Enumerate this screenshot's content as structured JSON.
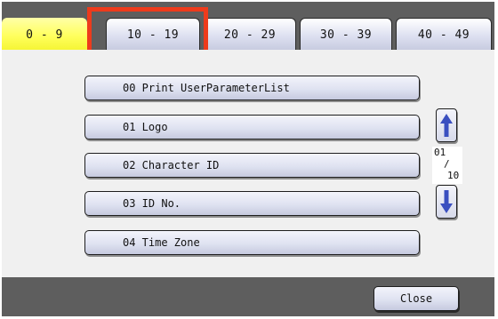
{
  "tabs": [
    {
      "label": "0 - 9",
      "active": true
    },
    {
      "label": "10 - 19",
      "active": false
    },
    {
      "label": "20 - 29",
      "active": false
    },
    {
      "label": "30 - 39",
      "active": false
    },
    {
      "label": "40 - 49",
      "active": false
    }
  ],
  "parameters": [
    {
      "label": "00  Print UserParameterList"
    },
    {
      "label": "01  Logo"
    },
    {
      "label": "02  Character ID"
    },
    {
      "label": "03  ID No."
    },
    {
      "label": "04  Time Zone"
    }
  ],
  "pager": {
    "current": "01",
    "separator": "/",
    "total": "10",
    "up_icon": "arrow-up-icon",
    "down_icon": "arrow-down-icon"
  },
  "footer": {
    "close_label": "Close"
  },
  "colors": {
    "active_tab": "#ffff5c",
    "highlight": "#ee3b1c",
    "arrow": "#3a4fc0",
    "frame": "#5e5e5e"
  }
}
